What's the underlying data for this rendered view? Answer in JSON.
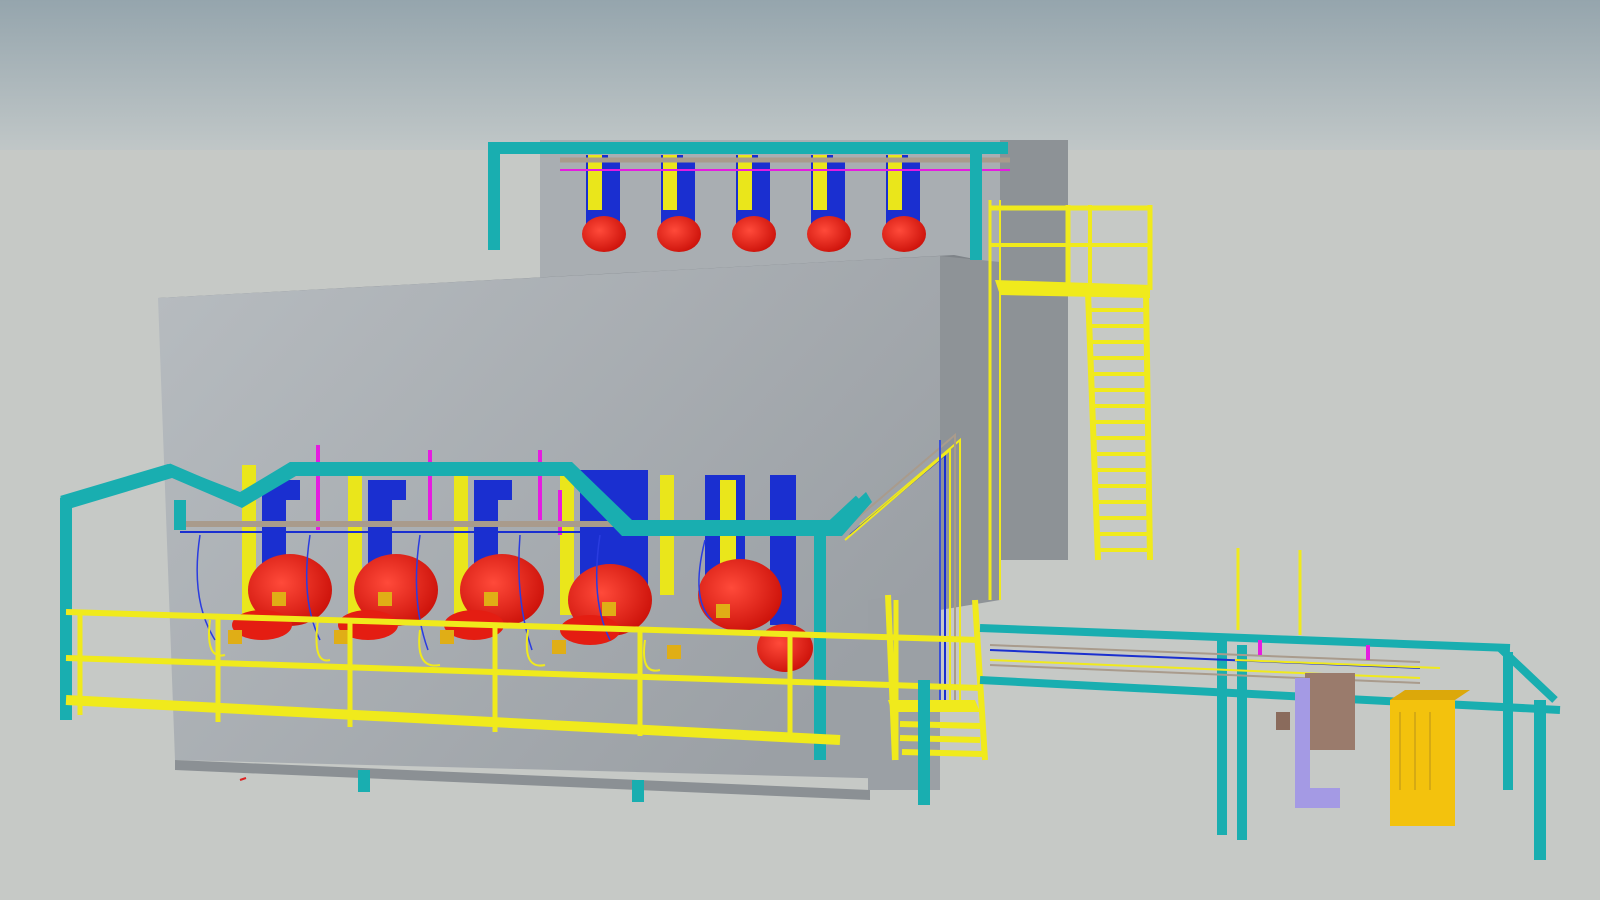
{
  "scene": {
    "description_free": true,
    "colors": {
      "sky_top": "#95a5ad",
      "sky_bottom": "#c0c6c7",
      "ground": "#c6c9c6",
      "building_front": "#a8adb1",
      "building_side": "#8e9397",
      "building_roof": "#7c8186",
      "steel_frame": "#19aeb0",
      "railing": "#f0ea1c",
      "burner_red": "#e41d12",
      "burner_blue": "#1a2fd0",
      "duct_yellow": "#eae61b",
      "accent_magenta": "#e51ce0",
      "junction_box": "#e0ae16",
      "cabinet_yellow": "#f3c20d",
      "lavender_duct": "#a49ae4",
      "brown_box": "#9a7b6c"
    },
    "upper_burners": 5,
    "lower_burners": 5,
    "stair_treads": 16
  }
}
